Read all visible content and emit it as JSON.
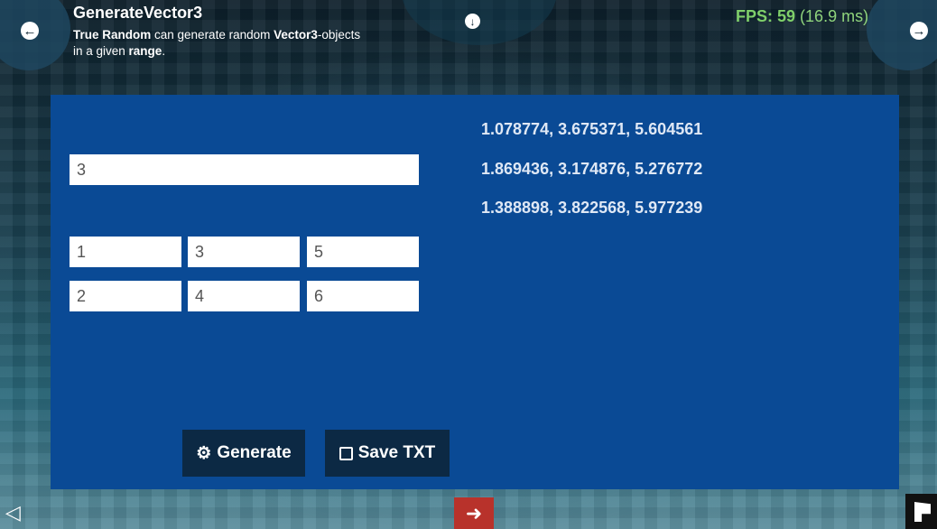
{
  "header": {
    "title": "GenerateVector3",
    "desc_bold1": "True Random",
    "desc_text1": " can generate random ",
    "desc_bold2": "Vector3",
    "desc_text2": "-objects",
    "desc_text3": "in a given ",
    "desc_bold3": "range",
    "desc_text4": "."
  },
  "fps": {
    "label": "FPS: 59",
    "ms": "(16.9 ms)"
  },
  "inputs": {
    "count": "3",
    "min_x": "1",
    "min_y": "3",
    "min_z": "5",
    "max_x": "2",
    "max_y": "4",
    "max_z": "6"
  },
  "results": [
    "1.078774, 3.675371, 5.604561",
    "1.869436, 3.174876, 5.276772",
    "1.388898, 3.822568, 5.977239"
  ],
  "buttons": {
    "generate": "Generate",
    "save": "Save TXT"
  },
  "colors": {
    "panel": "#0a4a95",
    "button": "#0c2944",
    "fps": "#7fcf6a",
    "exit": "#b8322b"
  }
}
